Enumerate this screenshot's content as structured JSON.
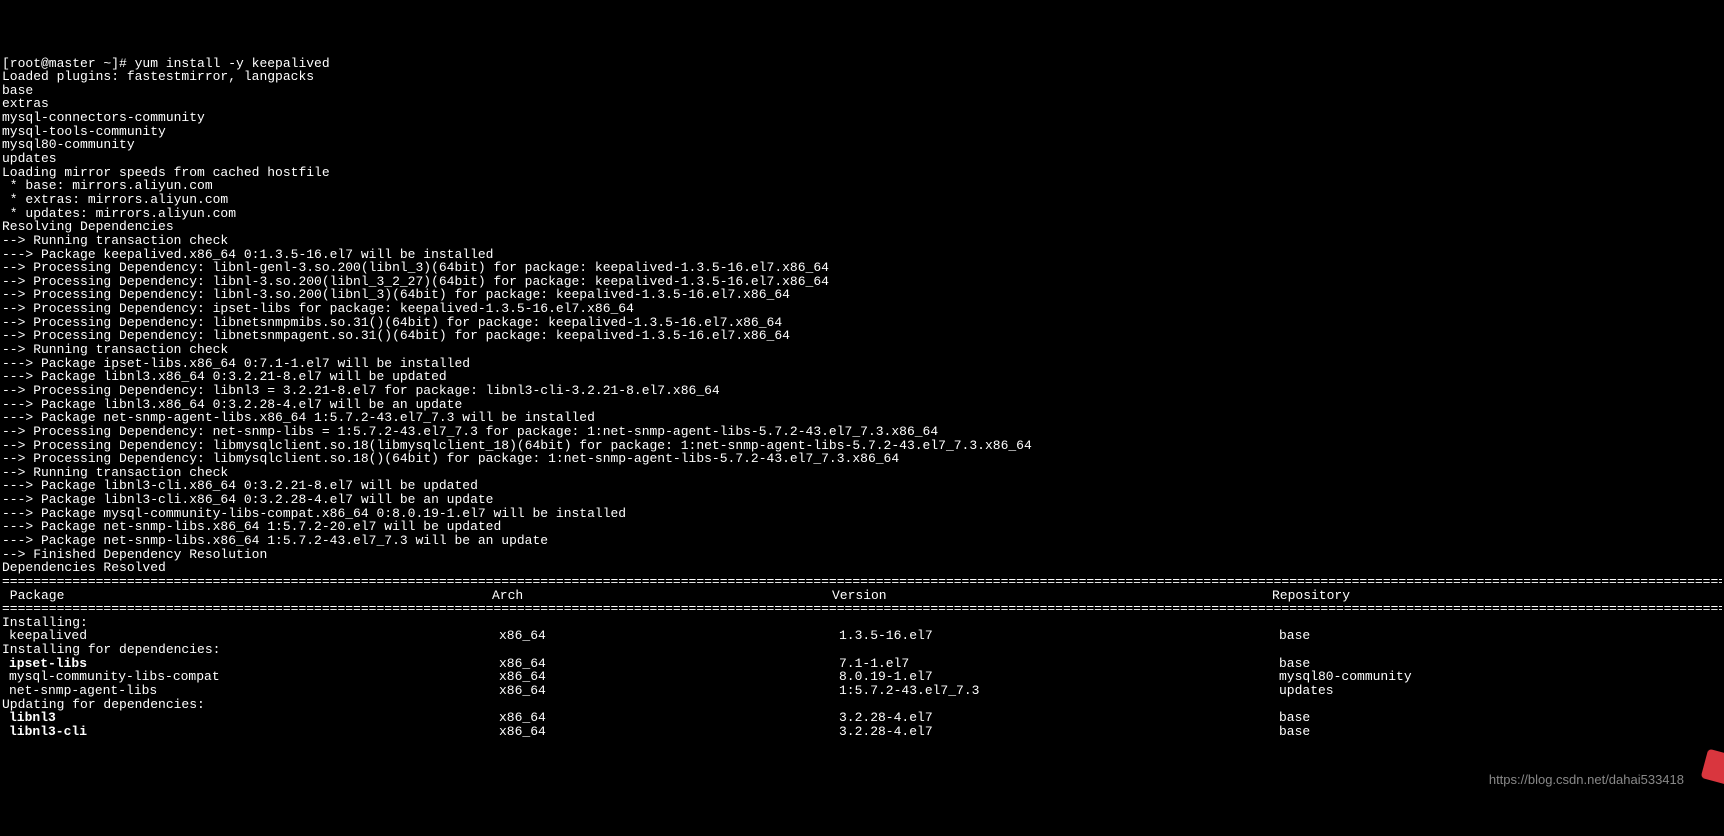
{
  "prompt": "[root@master ~]# yum install -y keepalived",
  "lines": [
    "Loaded plugins: fastestmirror, langpacks",
    "base",
    "extras",
    "mysql-connectors-community",
    "mysql-tools-community",
    "mysql80-community",
    "updates",
    "Loading mirror speeds from cached hostfile",
    " * base: mirrors.aliyun.com",
    " * extras: mirrors.aliyun.com",
    " * updates: mirrors.aliyun.com",
    "Resolving Dependencies",
    "--> Running transaction check",
    "---> Package keepalived.x86_64 0:1.3.5-16.el7 will be installed",
    "--> Processing Dependency: libnl-genl-3.so.200(libnl_3)(64bit) for package: keepalived-1.3.5-16.el7.x86_64",
    "--> Processing Dependency: libnl-3.so.200(libnl_3_2_27)(64bit) for package: keepalived-1.3.5-16.el7.x86_64",
    "--> Processing Dependency: libnl-3.so.200(libnl_3)(64bit) for package: keepalived-1.3.5-16.el7.x86_64",
    "--> Processing Dependency: ipset-libs for package: keepalived-1.3.5-16.el7.x86_64",
    "--> Processing Dependency: libnetsnmpmibs.so.31()(64bit) for package: keepalived-1.3.5-16.el7.x86_64",
    "--> Processing Dependency: libnetsnmpagent.so.31()(64bit) for package: keepalived-1.3.5-16.el7.x86_64",
    "--> Running transaction check",
    "---> Package ipset-libs.x86_64 0:7.1-1.el7 will be installed",
    "---> Package libnl3.x86_64 0:3.2.21-8.el7 will be updated",
    "--> Processing Dependency: libnl3 = 3.2.21-8.el7 for package: libnl3-cli-3.2.21-8.el7.x86_64",
    "---> Package libnl3.x86_64 0:3.2.28-4.el7 will be an update",
    "---> Package net-snmp-agent-libs.x86_64 1:5.7.2-43.el7_7.3 will be installed",
    "--> Processing Dependency: net-snmp-libs = 1:5.7.2-43.el7_7.3 for package: 1:net-snmp-agent-libs-5.7.2-43.el7_7.3.x86_64",
    "--> Processing Dependency: libmysqlclient.so.18(libmysqlclient_18)(64bit) for package: 1:net-snmp-agent-libs-5.7.2-43.el7_7.3.x86_64",
    "--> Processing Dependency: libmysqlclient.so.18()(64bit) for package: 1:net-snmp-agent-libs-5.7.2-43.el7_7.3.x86_64",
    "--> Running transaction check",
    "---> Package libnl3-cli.x86_64 0:3.2.21-8.el7 will be updated",
    "---> Package libnl3-cli.x86_64 0:3.2.28-4.el7 will be an update",
    "---> Package mysql-community-libs-compat.x86_64 0:8.0.19-1.el7 will be installed",
    "---> Package net-snmp-libs.x86_64 1:5.7.2-20.el7 will be updated",
    "---> Package net-snmp-libs.x86_64 1:5.7.2-43.el7_7.3 will be an update",
    "--> Finished Dependency Resolution",
    "",
    "Dependencies Resolved",
    ""
  ],
  "table_header": {
    "package": " Package",
    "arch": "Arch",
    "version": "Version",
    "repository": "Repository"
  },
  "sections": {
    "installing": "Installing:",
    "installing_deps": "Installing for dependencies:",
    "updating_deps": "Updating for dependencies:"
  },
  "packages": {
    "installing": [
      {
        "name": "keepalived",
        "arch": "x86_64",
        "version": "1.3.5-16.el7",
        "repo": "base",
        "bold": false
      }
    ],
    "installing_deps": [
      {
        "name": "ipset-libs",
        "arch": "x86_64",
        "version": "7.1-1.el7",
        "repo": "base",
        "bold": true
      },
      {
        "name": "mysql-community-libs-compat",
        "arch": "x86_64",
        "version": "8.0.19-1.el7",
        "repo": "mysql80-community",
        "bold": false
      },
      {
        "name": "net-snmp-agent-libs",
        "arch": "x86_64",
        "version": "1:5.7.2-43.el7_7.3",
        "repo": "updates",
        "bold": false
      }
    ],
    "updating_deps": [
      {
        "name": "libnl3",
        "arch": "x86_64",
        "version": "3.2.28-4.el7",
        "repo": "base",
        "bold": true
      },
      {
        "name": "libnl3-cli",
        "arch": "x86_64",
        "version": "3.2.28-4.el7",
        "repo": "base",
        "bold": true
      }
    ]
  },
  "watermark": "https://blog.csdn.net/dahai533418"
}
